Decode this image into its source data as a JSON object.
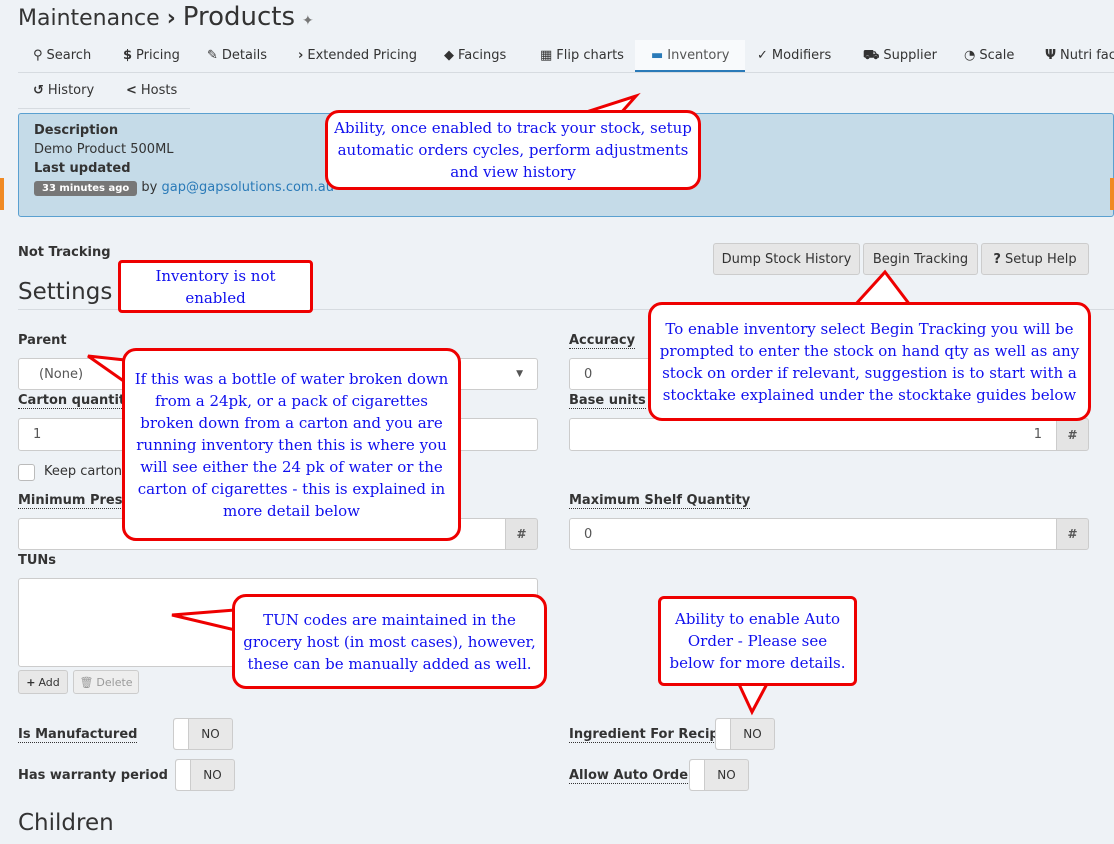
{
  "header": {
    "breadcrumb_parent": "Maintenance",
    "separator": "›",
    "title": "Products",
    "pin_icon": "pin-icon"
  },
  "tabs": [
    {
      "label": "Search",
      "icon": "search-icon",
      "glyph": "⚲"
    },
    {
      "label": "Pricing",
      "icon": "dollar-icon",
      "glyph": "$"
    },
    {
      "label": "Details",
      "icon": "edit-icon",
      "glyph": "✎"
    },
    {
      "label": "Extended Pricing",
      "icon": "chevron-right-icon",
      "glyph": "›"
    },
    {
      "label": "Facings",
      "icon": "tags-icon",
      "glyph": "◆"
    },
    {
      "label": "Flip charts",
      "icon": "grid-icon",
      "glyph": "▦"
    },
    {
      "label": "Inventory",
      "icon": "archive-icon",
      "glyph": "▬",
      "active": true
    },
    {
      "label": "Modifiers",
      "icon": "check-circle-icon",
      "glyph": "✓"
    },
    {
      "label": "Supplier",
      "icon": "truck-icon",
      "glyph": "⛟"
    },
    {
      "label": "Scale",
      "icon": "gauge-icon",
      "glyph": "◔"
    },
    {
      "label": "Nutri fact",
      "icon": "cutlery-icon",
      "glyph": "Ψ"
    },
    {
      "label": "History",
      "icon": "history-icon",
      "glyph": "↺"
    },
    {
      "label": "Hosts",
      "icon": "share-icon",
      "glyph": "<"
    }
  ],
  "info": {
    "description_label": "Description",
    "description": "Demo Product 500ML",
    "last_updated_label": "Last updated",
    "time_badge": "33 minutes ago",
    "by": "by",
    "user": "gap@gapsolutions.com.au"
  },
  "status": "Not Tracking",
  "buttons": {
    "dump": "Dump Stock History",
    "begin": "Begin Tracking",
    "help": "Setup Help"
  },
  "settings": {
    "heading": "Settings",
    "parent_label": "Parent",
    "parent_value": "(None)",
    "accuracy_label": "Accuracy",
    "accuracy_value": "0",
    "carton_label": "Carton quantity",
    "carton_value": "1",
    "base_units_label": "Base units",
    "base_units_value": "1",
    "keep_carton_label": "Keep carton e",
    "min_label": "Minimum Prese",
    "max_label": "Maximum Shelf Quantity",
    "max_value": "0",
    "hash": "#",
    "tuns_label": "TUNs",
    "add": "Add",
    "delete": "Delete",
    "is_manufactured_label": "Is Manufactured",
    "is_manufactured": "NO",
    "warranty_label": "Has warranty period",
    "warranty": "NO",
    "ingredient_label": "Ingredient For Recipe",
    "ingredient": "NO",
    "auto_order_label": "Allow Auto Order",
    "auto_order": "NO"
  },
  "children_heading": "Children",
  "callouts": [
    "Ability, once enabled to track your stock, setup automatic orders cycles, perform adjustments and view history",
    "Inventory is not enabled",
    "To enable inventory select Begin Tracking you will be prompted to enter the stock on hand qty as well as any stock on order if relevant, suggestion is to start with a stocktake explained under the stocktake guides below",
    "If this was a bottle of water broken down from a 24pk, or a pack of cigarettes broken down from a carton and you are running inventory then this is where you will see either the 24 pk of water or the carton of cigarettes - this is explained in more detail below",
    "TUN codes are maintained in the grocery host (in most cases), however, these can be manually added as well.",
    "Ability to enable Auto Order - Please see below for more details."
  ],
  "colors": {
    "accent": "#2a7ab8",
    "callout_border": "#ee0000",
    "callout_text": "#1010ee",
    "panel": "#c5dbe8"
  }
}
